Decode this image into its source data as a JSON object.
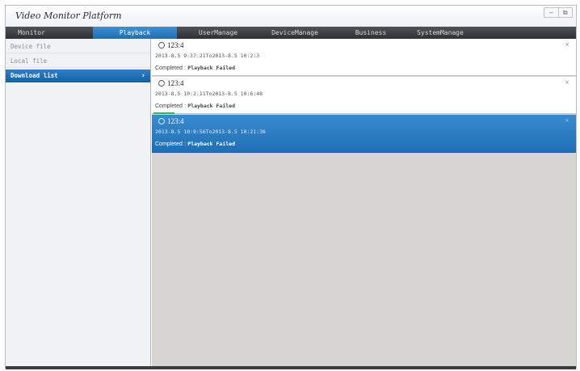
{
  "window": {
    "title": "Video Monitor Platform",
    "controls": {
      "minimize": "—",
      "restore": "⧉"
    }
  },
  "menu": {
    "items": [
      {
        "label": "Monitor",
        "active": false
      },
      {
        "label": "Playback",
        "active": true
      },
      {
        "label": "UserManage",
        "active": false
      },
      {
        "label": "DeviceManage",
        "active": false
      },
      {
        "label": "Business",
        "active": false
      },
      {
        "label": "SystemManage",
        "active": false
      }
    ]
  },
  "sidebar": {
    "items": [
      {
        "label": "Device file",
        "active": false
      },
      {
        "label": "Local file",
        "active": false
      },
      {
        "label": "Download list",
        "active": true,
        "arrow": "›"
      }
    ]
  },
  "downloads": [
    {
      "name": "123:4",
      "time_range": "2013-8.5 9:37:21To2013-8.5 10:2:3",
      "status_label": "Completed",
      "status_sep": ":",
      "status_text": "Playback Failed",
      "close": "×",
      "selected": false,
      "progress": 0
    },
    {
      "name": "123:4",
      "time_range": "2013-8.5 10:2:11To2013-8.5 10:6:48",
      "status_label": "Completed",
      "status_sep": ":",
      "status_text": "Playback Failed",
      "close": "×",
      "selected": false,
      "progress": 1
    },
    {
      "name": "123:4",
      "time_range": "2013-8.5 10:9:56To2013-8.5 10:21:36",
      "status_label": "Completed",
      "status_sep": ":",
      "status_text": "Playback Failed",
      "close": "×",
      "selected": true,
      "progress": 0
    }
  ],
  "colors": {
    "accent": "#2a7bc3",
    "menubar": "#3a3d41",
    "content_bg": "#d6d5d2",
    "progress": "#33b84a"
  }
}
